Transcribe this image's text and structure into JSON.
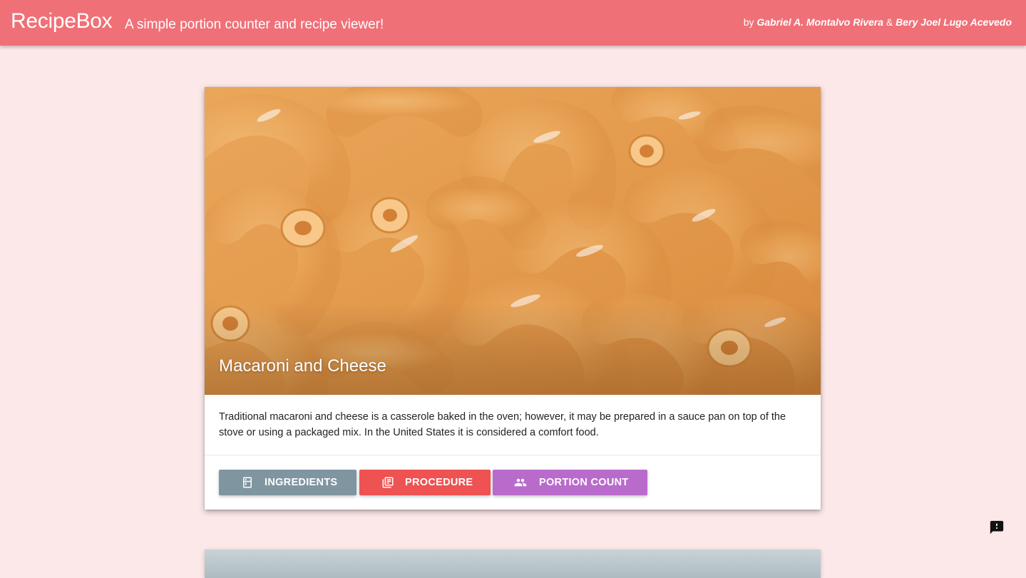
{
  "header": {
    "brand": "RecipeBox",
    "tagline": "A simple portion counter and recipe viewer!",
    "by_prefix": "by",
    "author1": "Gabriel A. Montalvo Rivera",
    "amp": "&",
    "author2": "Bery Joel Lugo Acevedo",
    "color": "#f07078"
  },
  "recipe": {
    "title": "Macaroni and Cheese",
    "description": "Traditional macaroni and cheese is a casserole baked in the oven; however, it may be prepared in a sauce pan on top of the stove or using a packaged mix. In the United States it is considered a comfort food.",
    "image_icon": "macaroni-photo"
  },
  "actions": {
    "ingredients_label": "INGREDIENTS",
    "ingredients_icon": "fridge-icon",
    "ingredients_color": "#7f95a0",
    "procedure_label": "PROCEDURE",
    "procedure_icon": "library-books-icon",
    "procedure_color": "#ee5252",
    "portion_label": "PORTION COUNT",
    "portion_icon": "people-icon",
    "portion_color": "#b96bcb"
  },
  "floating": {
    "feedback_icon": "feedback-icon"
  }
}
